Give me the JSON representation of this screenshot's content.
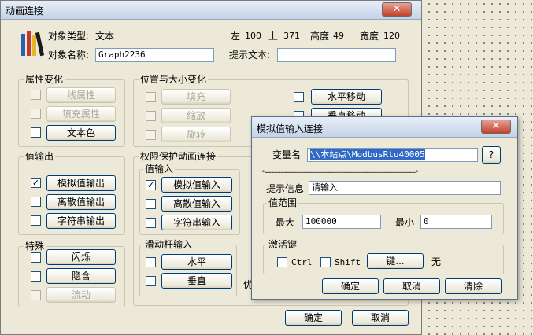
{
  "main": {
    "title": "动画连接",
    "close_glyph": "✕",
    "type_label": "对象类型:",
    "type_value": "文本",
    "left_label": "左",
    "left_value": "100",
    "top_label": "上",
    "top_value": "371",
    "height_label": "高度",
    "height_value": "49",
    "width_label": "宽度",
    "width_value": "120",
    "name_label": "对象名称:",
    "name_value": "Graph2236",
    "hint_label": "提示文本:",
    "hint_value": "",
    "attr_group": "属性变化",
    "attr_items": [
      "线属性",
      "填充属性",
      "文本色"
    ],
    "pos_group": "位置与大小变化",
    "pos_items": [
      "填充",
      "缩放",
      "旋转"
    ],
    "pos_items_right": [
      "水平移动",
      "垂直移动"
    ],
    "value_out_group": "值输出",
    "value_out_items": [
      "模拟值输出",
      "离散值输出",
      "字符串输出"
    ],
    "perm_group": "权限保护动画连接",
    "value_in_group": "值输入",
    "value_in_items": [
      "模拟值输入",
      "离散值输入",
      "字符串输入"
    ],
    "special_group": "特殊",
    "special_items": [
      "闪烁",
      "隐含",
      "流动"
    ],
    "slider_group": "滑动杆输入",
    "slider_items": [
      "水平",
      "垂直"
    ],
    "priority_label": "优",
    "ok": "确定",
    "cancel": "取消"
  },
  "dialog": {
    "title": "模拟值输入连接",
    "close_glyph": "✕",
    "var_label": "变量名",
    "var_value": "\\\\本站点\\ModbusRtu40005",
    "var_button": "?",
    "separator": "*================================================*",
    "hint_label": "提示信息",
    "hint_value": "请输入",
    "range_group": "值范围",
    "max_label": "最大",
    "max_value": "100000",
    "min_label": "最小",
    "min_value": "0",
    "activate_group": "激活键",
    "ctrl_label": "Ctrl",
    "shift_label": "Shift",
    "key_button": "键...",
    "key_value": "无",
    "ok": "确定",
    "cancel": "取消",
    "clear": "清除"
  }
}
